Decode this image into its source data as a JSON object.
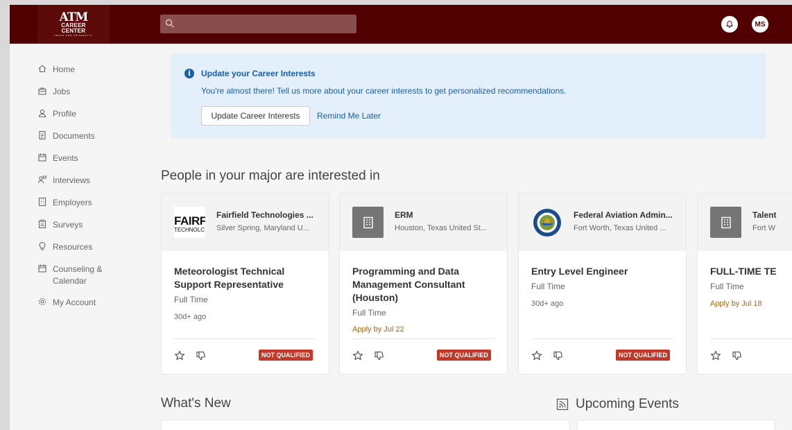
{
  "brand": {
    "logo_mark": "ATM",
    "logo_line1": "CAREER",
    "logo_line2": "CENTER",
    "logo_sub": "TEXAS A&M UNIVERSITY",
    "primary_color": "#500000"
  },
  "header": {
    "search_placeholder": "",
    "avatar_initials": "MS"
  },
  "sidebar": {
    "items": [
      {
        "label": "Home",
        "icon": "home-icon"
      },
      {
        "label": "Jobs",
        "icon": "briefcase-icon"
      },
      {
        "label": "Profile",
        "icon": "person-icon"
      },
      {
        "label": "Documents",
        "icon": "document-icon"
      },
      {
        "label": "Events",
        "icon": "calendar-icon"
      },
      {
        "label": "Interviews",
        "icon": "interview-icon"
      },
      {
        "label": "Employers",
        "icon": "building-icon"
      },
      {
        "label": "Surveys",
        "icon": "clipboard-icon"
      },
      {
        "label": "Resources",
        "icon": "lightbulb-icon"
      },
      {
        "label": "Counseling &",
        "label2": "Calendar",
        "icon": "calendar-icon"
      },
      {
        "label": "My Account",
        "icon": "gear-icon"
      }
    ]
  },
  "banner": {
    "title": "Update your Career Interests",
    "description": "You're almost there! Tell us more about your career interests to get personalized recommendations.",
    "primary_button": "Update Career Interests",
    "secondary_link": "Remind Me Later"
  },
  "recommendations": {
    "title": "People in your major are interested in",
    "cards": [
      {
        "company": "Fairfield Technologies ...",
        "location": "Silver Spring, Maryland U...",
        "logo_text": "FAIRF",
        "logo_sub": "TECHNOLC",
        "title": "Meteorologist Technical Support Representative",
        "job_type": "Full Time",
        "age": "30d+ ago",
        "apply_by": "",
        "badge": "NOT QUALIFIED"
      },
      {
        "company": "ERM",
        "location": "Houston, Texas United St...",
        "title": "Programming and Data Management Consultant (Houston)",
        "job_type": "Full Time",
        "age": "",
        "apply_by": "Apply by Jul 22",
        "badge": "NOT QUALIFIED"
      },
      {
        "company": "Federal Aviation Admin...",
        "location": "Fort Worth, Texas United ...",
        "title": "Entry Level Engineer",
        "job_type": "Full Time",
        "age": "30d+ ago",
        "apply_by": "",
        "badge": "NOT QUALIFIED"
      },
      {
        "company": "Talent",
        "location": "Fort W",
        "title": "FULL-TIME TE",
        "job_type": "Full Time",
        "age": "",
        "apply_by": "Apply by Jul 18",
        "badge": ""
      }
    ]
  },
  "whats_new": {
    "title": "What's New"
  },
  "upcoming_events": {
    "title": "Upcoming Events"
  }
}
